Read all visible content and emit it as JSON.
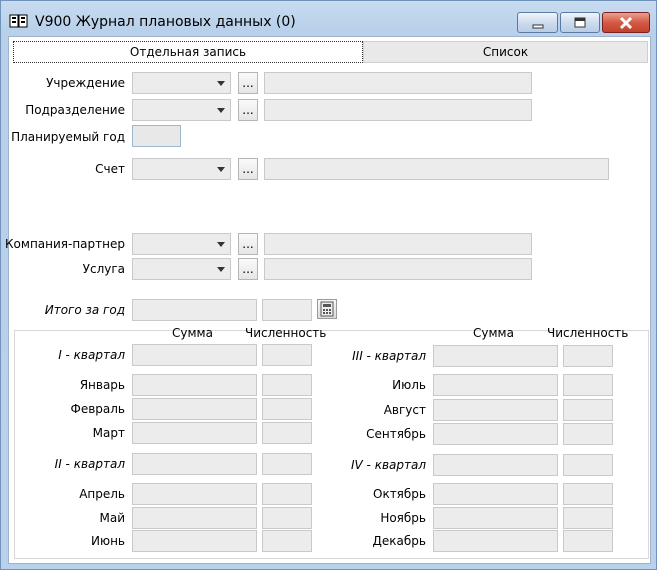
{
  "window": {
    "title": "V900 Журнал плановых данных (0)"
  },
  "tabs": {
    "single": "Отдельная запись",
    "list": "Список"
  },
  "form": {
    "institution_label": "Учреждение",
    "department_label": "Подразделение",
    "year_label": "Планируемый год",
    "account_label": "Счет",
    "partner_label": "Компания-партнер",
    "service_label": "Услуга",
    "total_label": "Итого за год",
    "ellipsis": "...",
    "institution_value": "",
    "department_value": "",
    "year_value": "",
    "account_value": "",
    "partner_value": "",
    "service_value": ""
  },
  "grid": {
    "sum_header": "Сумма",
    "count_header": "Численность",
    "q1": "I - квартал",
    "q2": "II - квартал",
    "q3": "III - квартал",
    "q4": "IV - квартал",
    "months": [
      "Январь",
      "Февраль",
      "Март",
      "Апрель",
      "Май",
      "Июнь",
      "Июль",
      "Август",
      "Сентябрь",
      "Октябрь",
      "Ноябрь",
      "Декабрь"
    ]
  },
  "icons": {
    "window": "book-icon",
    "calc": "calculator-icon",
    "dropdown": "chevron-down-icon"
  }
}
